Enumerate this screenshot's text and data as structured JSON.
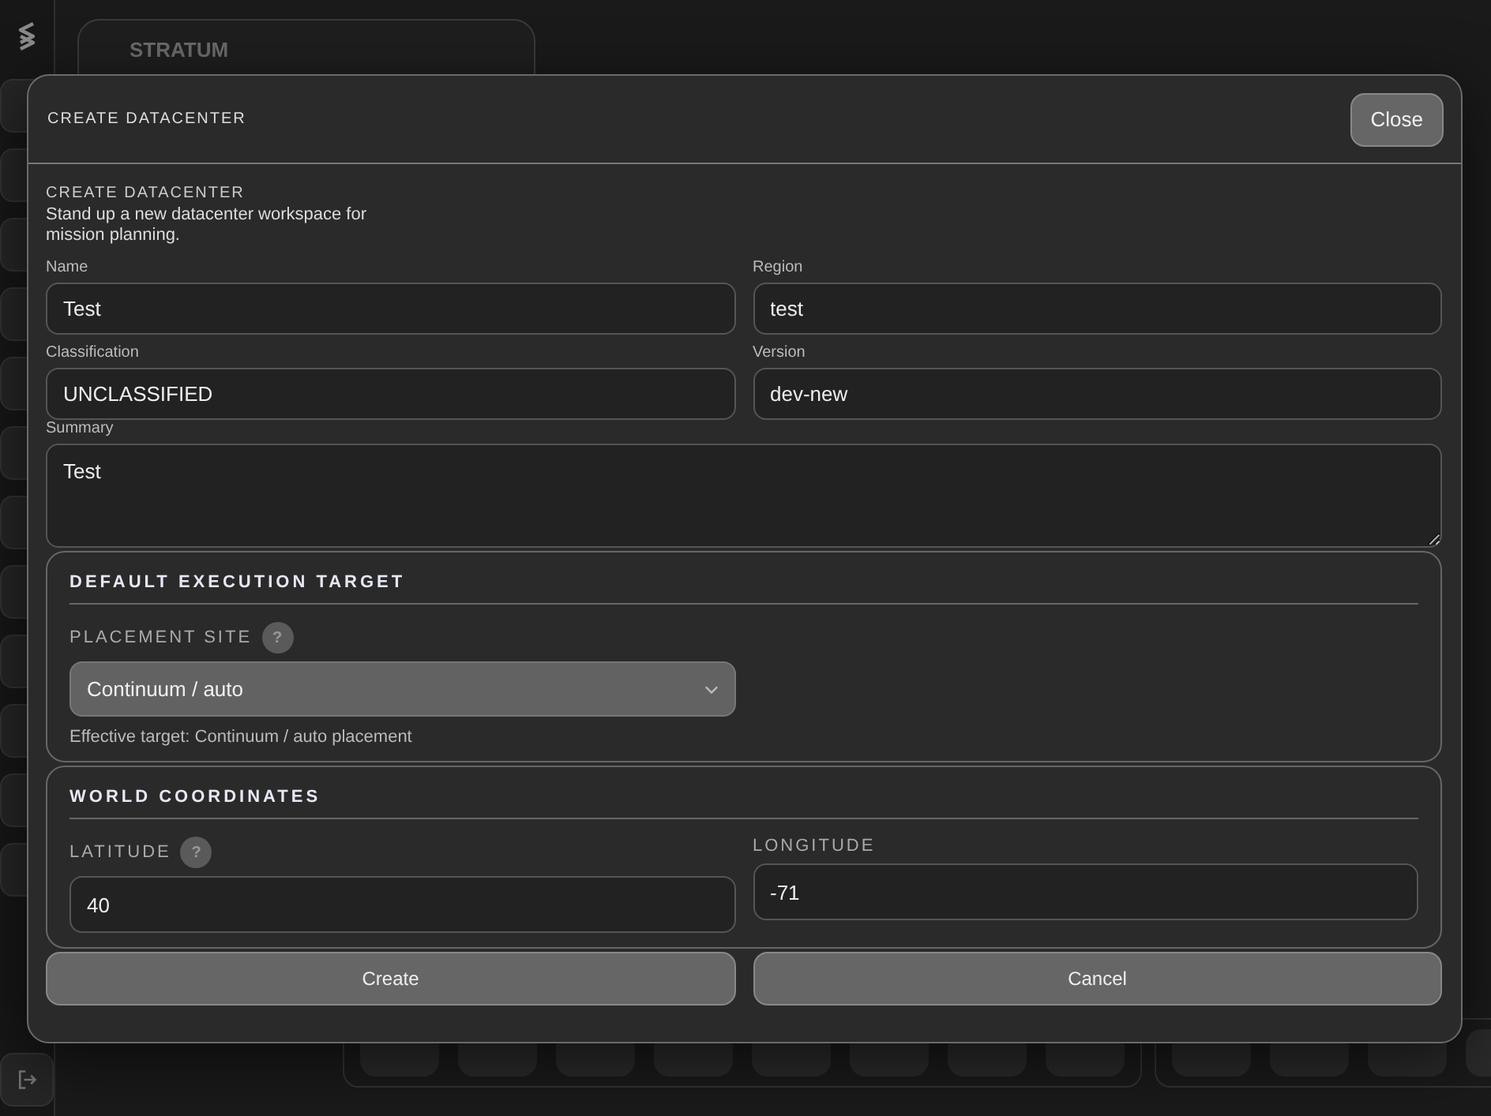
{
  "app": {
    "header": {
      "title": "STRATUM"
    }
  },
  "dialog": {
    "title": "CREATE DATACENTER",
    "close": "Close",
    "heading": "CREATE DATACENTER",
    "description": "Stand up a new datacenter workspace for mission planning.",
    "fields": [
      {
        "label": "Name",
        "value": "Test"
      },
      {
        "label": "Region",
        "value": "test"
      },
      {
        "label": "Classification",
        "value": "UNCLASSIFIED"
      },
      {
        "label": "Version",
        "value": "dev-new"
      }
    ],
    "summary": {
      "label": "Summary",
      "value": "Test"
    },
    "sections": [
      {
        "title": "DEFAULT EXECUTION TARGET",
        "fields": [
          {
            "kind": "select",
            "label": "PLACEMENT SITE",
            "help": "?",
            "value": "Continuum / auto",
            "note": "Effective target: Continuum / auto placement"
          }
        ]
      },
      {
        "title": "WORLD COORDINATES",
        "fields": [
          {
            "kind": "input",
            "label": "LATITUDE",
            "help": "?",
            "value": "40"
          },
          {
            "kind": "input",
            "label": "LONGITUDE",
            "value": "-71"
          }
        ]
      }
    ],
    "buttons": [
      "Create",
      "Cancel"
    ]
  }
}
